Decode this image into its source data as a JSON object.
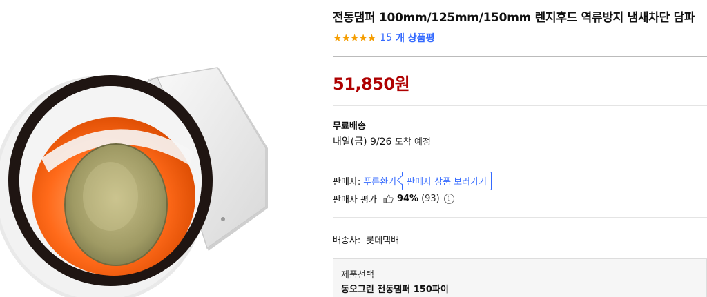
{
  "product": {
    "title": "전동댐퍼 100mm/125mm/150mm 렌지후드 역류방지 냄새차단 담파",
    "stars": "★★★★★",
    "review_count": "15",
    "review_word": "개 상품평",
    "price": "51,850원"
  },
  "shipping": {
    "label": "무료배송",
    "arrival_date": "내일(금) 9/26",
    "arrival_suffix": "도착 예정"
  },
  "seller": {
    "label": "판매자:",
    "name": "푸른환기",
    "button_label": "판매자 상품 보러가기",
    "eval_label": "판매자 평가",
    "eval_percent": "94%",
    "eval_count": "(93)",
    "info_glyph": "i"
  },
  "delivery": {
    "label": "배송사:",
    "carrier": "롯데택배"
  },
  "option": {
    "label": "제품선택",
    "value": "동오그린 전동댐퍼 150파이"
  },
  "colors": {
    "price": "#ae0000",
    "link": "#346aff",
    "star": "#f59d00"
  }
}
